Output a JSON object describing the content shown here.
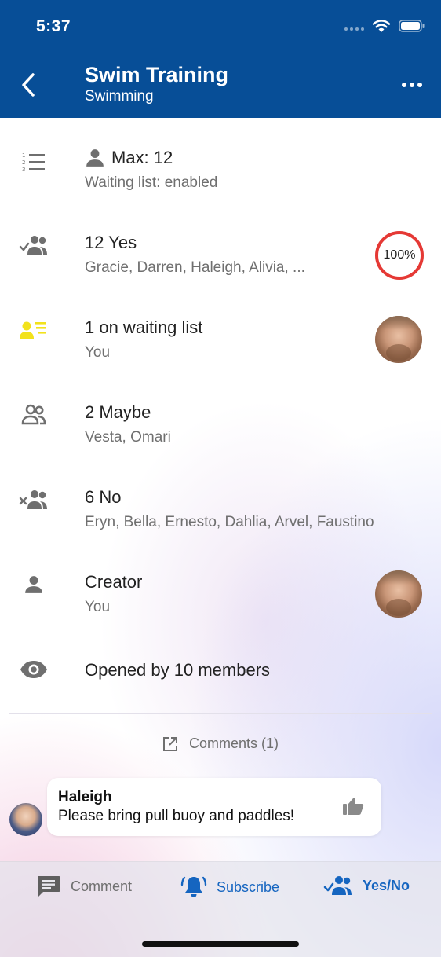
{
  "status_bar": {
    "time": "5:37"
  },
  "header": {
    "title": "Swim Training",
    "subtitle": "Swimming"
  },
  "rows": [
    {
      "icon": "numbered-list-icon",
      "primary": "Max: 12",
      "secondary": "Waiting list: enabled"
    },
    {
      "icon": "group-check-icon",
      "primary": "12 Yes",
      "secondary": "Gracie, Darren, Haleigh, Alivia, ...",
      "badge": "100%"
    },
    {
      "icon": "waiting-list-icon",
      "primary": "1 on waiting list",
      "secondary": "You"
    },
    {
      "icon": "group-icon",
      "primary": "2 Maybe",
      "secondary": "Vesta, Omari"
    },
    {
      "icon": "group-x-icon",
      "primary": "6 No",
      "secondary": "Eryn, Bella, Ernesto, Dahlia, Arvel, Faustino"
    },
    {
      "icon": "person-icon",
      "primary": "Creator",
      "secondary": "You"
    },
    {
      "icon": "eye-icon",
      "primary": "Opened by 10 members"
    }
  ],
  "comments": {
    "link_label": "Comments (1)",
    "items": [
      {
        "author": "Haleigh",
        "text": "Please bring pull buoy and paddles!"
      }
    ]
  },
  "bottom_bar": {
    "comment": "Comment",
    "subscribe": "Subscribe",
    "yes_no": "Yes/No"
  },
  "colors": {
    "header_bg": "#074e97",
    "accent_blue": "#1565c0",
    "badge_ring": "#e53935",
    "waiting_icon": "#f2e21c",
    "icon_gray": "#6f6f6f"
  }
}
